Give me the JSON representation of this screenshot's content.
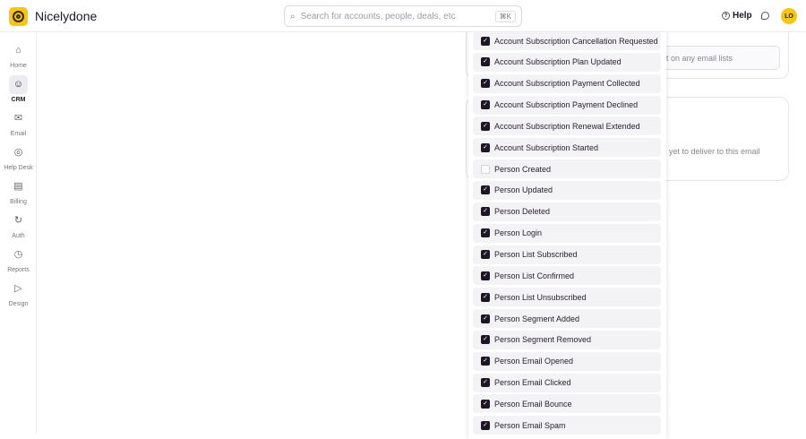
{
  "app": {
    "name": "Nicelydone",
    "search_placeholder": "Search for accounts, people, deals, etc",
    "search_shortcut": "⌘K",
    "help": "Help",
    "avatar": "LO"
  },
  "sidebar": [
    {
      "label": "Home",
      "icon": "home-icon",
      "glyph": "⌂"
    },
    {
      "label": "CRM",
      "icon": "crm-icon",
      "glyph": "☺",
      "active": true
    },
    {
      "label": "Email",
      "icon": "email-icon",
      "glyph": "✉"
    },
    {
      "label": "Help Desk",
      "icon": "helpdesk-icon",
      "glyph": "◎"
    },
    {
      "label": "Billing",
      "icon": "billing-icon",
      "glyph": "▤"
    },
    {
      "label": "Auth",
      "icon": "auth-icon",
      "glyph": "↻"
    },
    {
      "label": "Reports",
      "icon": "reports-icon",
      "glyph": "◷"
    },
    {
      "label": "Design",
      "icon": "design-icon",
      "glyph": "▷"
    }
  ],
  "background": {
    "lists_text": "ot on any email lists",
    "deliver_text": "yet to deliver to this email"
  },
  "events": [
    {
      "label": "Account Subscription Cancellation Requested",
      "checked": true
    },
    {
      "label": "Account Subscription Plan Updated",
      "checked": true
    },
    {
      "label": "Account Subscription Payment Collected",
      "checked": true
    },
    {
      "label": "Account Subscription Payment Declined",
      "checked": true
    },
    {
      "label": "Account Subscription Renewal Extended",
      "checked": true
    },
    {
      "label": "Account Subscription Started",
      "checked": true
    },
    {
      "label": "Person Created",
      "checked": false
    },
    {
      "label": "Person Updated",
      "checked": true
    },
    {
      "label": "Person Deleted",
      "checked": true
    },
    {
      "label": "Person Login",
      "checked": true
    },
    {
      "label": "Person List Subscribed",
      "checked": true
    },
    {
      "label": "Person List Confirmed",
      "checked": true
    },
    {
      "label": "Person List Unsubscribed",
      "checked": true
    },
    {
      "label": "Person Segment Added",
      "checked": true
    },
    {
      "label": "Person Segment Removed",
      "checked": true
    },
    {
      "label": "Person Email Opened",
      "checked": true
    },
    {
      "label": "Person Email Clicked",
      "checked": true
    },
    {
      "label": "Person Email Bounce",
      "checked": true
    },
    {
      "label": "Person Email Spam",
      "checked": true
    }
  ]
}
